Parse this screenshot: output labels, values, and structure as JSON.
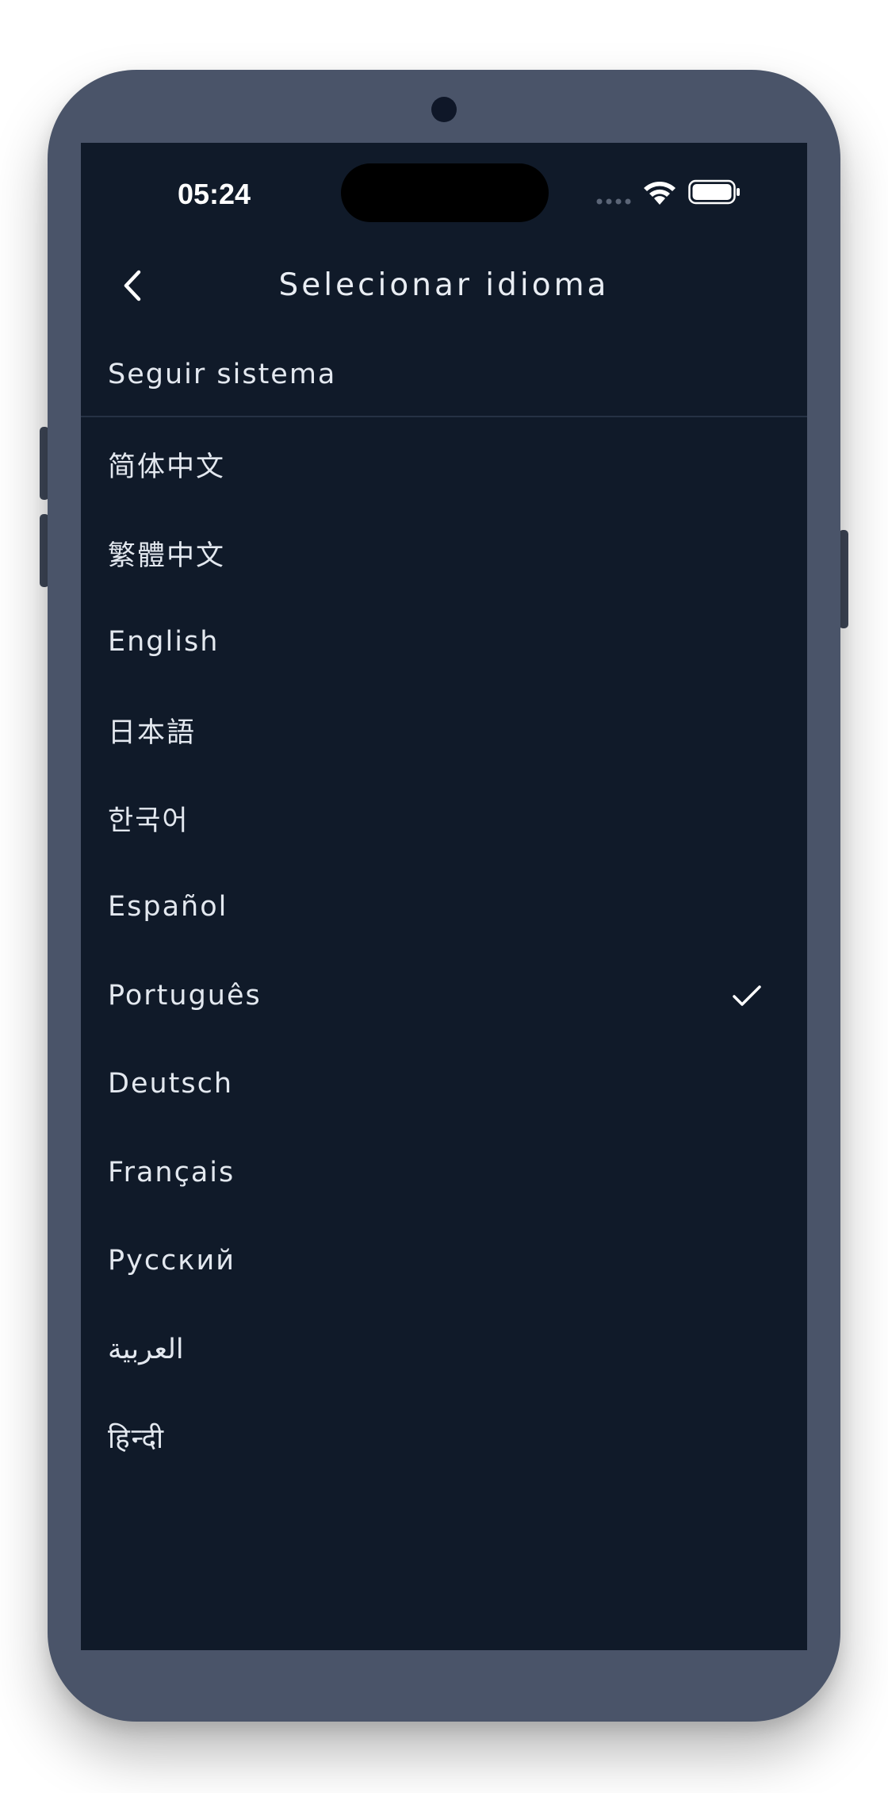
{
  "status_bar": {
    "time": "05:24",
    "icons": [
      "signal-icon",
      "wifi-icon",
      "battery-icon"
    ]
  },
  "nav": {
    "title": "Selecionar idioma",
    "back_icon": "chevron-left-icon"
  },
  "system_option": {
    "label": "Seguir sistema"
  },
  "languages": [
    {
      "label": "简体中文",
      "selected": false
    },
    {
      "label": "繁體中文",
      "selected": false
    },
    {
      "label": "English",
      "selected": false
    },
    {
      "label": "日本語",
      "selected": false
    },
    {
      "label": "한국어",
      "selected": false
    },
    {
      "label": "Español",
      "selected": false
    },
    {
      "label": "Português",
      "selected": true
    },
    {
      "label": "Deutsch",
      "selected": false
    },
    {
      "label": "Français",
      "selected": false
    },
    {
      "label": "Русский",
      "selected": false
    },
    {
      "label": "العربية",
      "selected": false
    },
    {
      "label": "हिन्दी",
      "selected": false
    }
  ],
  "colors": {
    "screen_background": "#101a29",
    "phone_frame": "#4a5469",
    "text_primary": "#e3e8ef",
    "divider": "#263244"
  }
}
